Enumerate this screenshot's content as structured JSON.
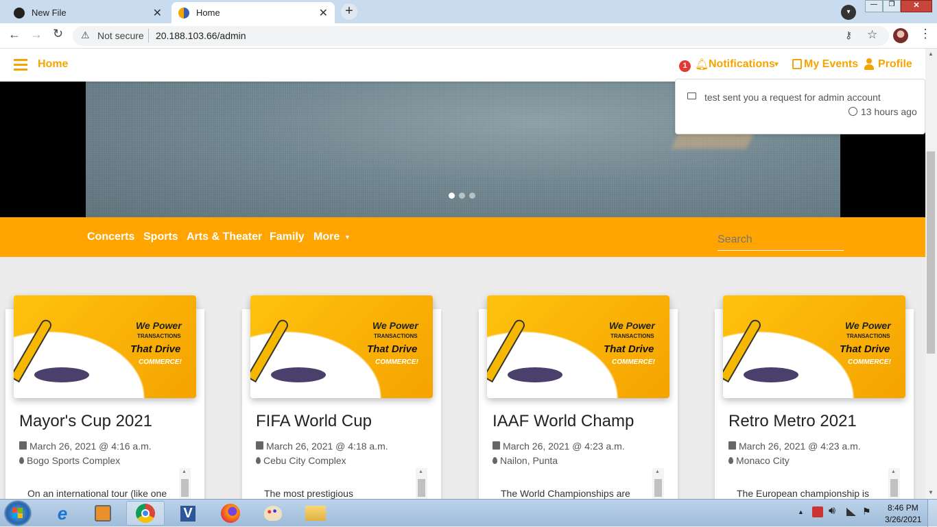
{
  "browser": {
    "tabs": [
      {
        "title": "New File"
      },
      {
        "title": "Home"
      }
    ],
    "security_label": "Not secure",
    "url": "20.188.103.66/admin"
  },
  "navbar": {
    "home": "Home",
    "notification_count": "1",
    "notifications": "Notifications",
    "my_events": "My Events",
    "profile": "Profile"
  },
  "notifications_dropdown": {
    "message": "test sent you a request for admin account",
    "time": "13 hours ago"
  },
  "carousel": {
    "indicator_count": 3,
    "active_index": 0
  },
  "categories": {
    "items": [
      "Concerts",
      "Sports",
      "Arts & Theater",
      "Family",
      "More"
    ],
    "search_placeholder": "Search"
  },
  "banner": {
    "line1": "We Power",
    "line2": "TRANSACTIONS",
    "line3": "That Drive",
    "line4": "COMMERCE!"
  },
  "events": [
    {
      "title": "Mayor's Cup 2021",
      "date": "March 26, 2021 @ 4:16 a.m.",
      "location": "Bogo Sports Complex",
      "description": "On an international tour (like one"
    },
    {
      "title": "FIFA World Cup",
      "date": "March 26, 2021 @ 4:18 a.m.",
      "location": "Cebu City Complex",
      "description": "The most prestigious"
    },
    {
      "title": "IAAF World Champ",
      "date": "March 26, 2021 @ 4:23 a.m.",
      "location": "Nailon, Punta",
      "description": "The World Championships are"
    },
    {
      "title": "Retro Metro 2021",
      "date": "March 26, 2021 @ 4:23 a.m.",
      "location": "Monaco City",
      "description": "The European championship is"
    }
  ],
  "taskbar": {
    "time": "8:46 PM",
    "date": "3/26/2021"
  },
  "colors": {
    "brand": "#ffa400",
    "nav_text": "#f5a300",
    "badge": "#e53935"
  }
}
